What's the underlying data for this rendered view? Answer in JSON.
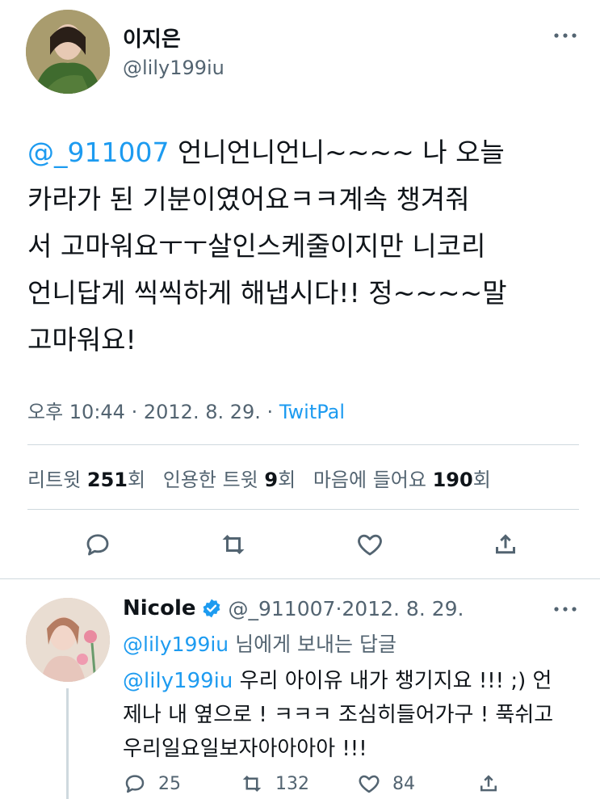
{
  "tweet": {
    "display_name": "이지은",
    "handle": "@lily199iu",
    "mention": "@_911007",
    "body_text": " 언니언니언니~~~~ 나 오늘\n카라가 된 기분이였어요ㅋㅋ계속 챙겨줘\n서 고마워요ㅜㅜ살인스케줄이지만 니코리\n언니답게 씩씩하게 해냅시다!! 정~~~~말\n고마워요!",
    "time": "오후 10:44",
    "date": "2012. 8. 29.",
    "source": "TwitPal",
    "retweet_label": "리트윗",
    "retweet_count": "251",
    "quote_label": "인용한 트윗",
    "quote_count": "9",
    "like_label": "마음에 들어요",
    "like_count": "190",
    "count_suffix": "회",
    "separator": "·"
  },
  "reply": {
    "display_name": "Nicole",
    "handle": "@_911007",
    "date": "2012. 8. 29.",
    "separator": "·",
    "replying_handle": "@lily199iu",
    "replying_suffix": " 님에게 보내는 답글",
    "mention": "@lily199iu",
    "body_text": " 우리 아이유 내가 챙기지요 !!! ;) 언\n제나 내 옆으로 ! ㅋㅋㅋ 조심히들어가구 ! 푹쉬고\n우리일요일보자아아아아 !!!",
    "reply_count": "25",
    "retweet_count": "132",
    "like_count": "84"
  },
  "icons": {
    "more": "more-icon",
    "reply": "reply-icon",
    "retweet": "retweet-icon",
    "like": "heart-icon",
    "share": "share-icon",
    "verified": "verified-badge-icon"
  },
  "colors": {
    "accent": "#1d9bf0",
    "text": "#0f1419",
    "muted": "#536471",
    "divider": "#cfd9de"
  }
}
